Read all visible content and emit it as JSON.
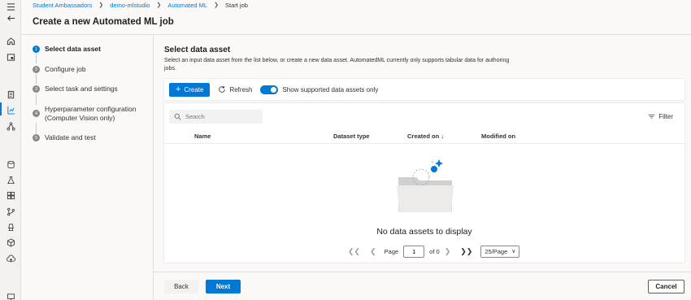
{
  "breadcrumb": {
    "items": [
      "Student Ambassadors",
      "demo-mlstudio",
      "Automated ML"
    ],
    "current": "Start job"
  },
  "page": {
    "title": "Create a new Automated ML job"
  },
  "steps": [
    {
      "number": "1",
      "label": "Select data asset",
      "active": true
    },
    {
      "number": "2",
      "label": "Configure job"
    },
    {
      "number": "3",
      "label": "Select task and settings"
    },
    {
      "number": "4",
      "label": "Hyperparameter configuration (Computer Vision only)"
    },
    {
      "number": "5",
      "label": "Validate and test"
    }
  ],
  "main": {
    "title": "Select data asset",
    "description": "Select an input data asset from the list below, or create a new data asset. AutomatedML currently only supports tabular data for authoring jobs."
  },
  "toolbar": {
    "create_label": "Create",
    "refresh_label": "Refresh",
    "toggle_label": "Show supported data assets only",
    "toggle_on": true
  },
  "table": {
    "search_placeholder": "Search",
    "filter_label": "Filter",
    "columns": [
      "Name",
      "Dataset type",
      "Created on ↓",
      "Modified on"
    ],
    "empty_message": "No data assets to display"
  },
  "pager": {
    "page_label": "Page",
    "page_value": "1",
    "of_label": "of 0",
    "page_size": "25/Page"
  },
  "footer": {
    "back_label": "Back",
    "next_label": "Next",
    "cancel_label": "Cancel"
  },
  "colors": {
    "accent": "#0078d4",
    "rail_bg": "#f3f2f1",
    "page_bg": "#faf9f8"
  },
  "rail_icons": [
    "hamburger-icon",
    "back-arrow-icon",
    "home-icon",
    "model-catalog-icon",
    "notebook-icon",
    "automl-icon",
    "designer-icon",
    "data-icon",
    "jobs-icon",
    "components-icon",
    "pipelines-icon",
    "environments-icon",
    "models-icon",
    "endpoints-icon",
    "compute-icon"
  ]
}
